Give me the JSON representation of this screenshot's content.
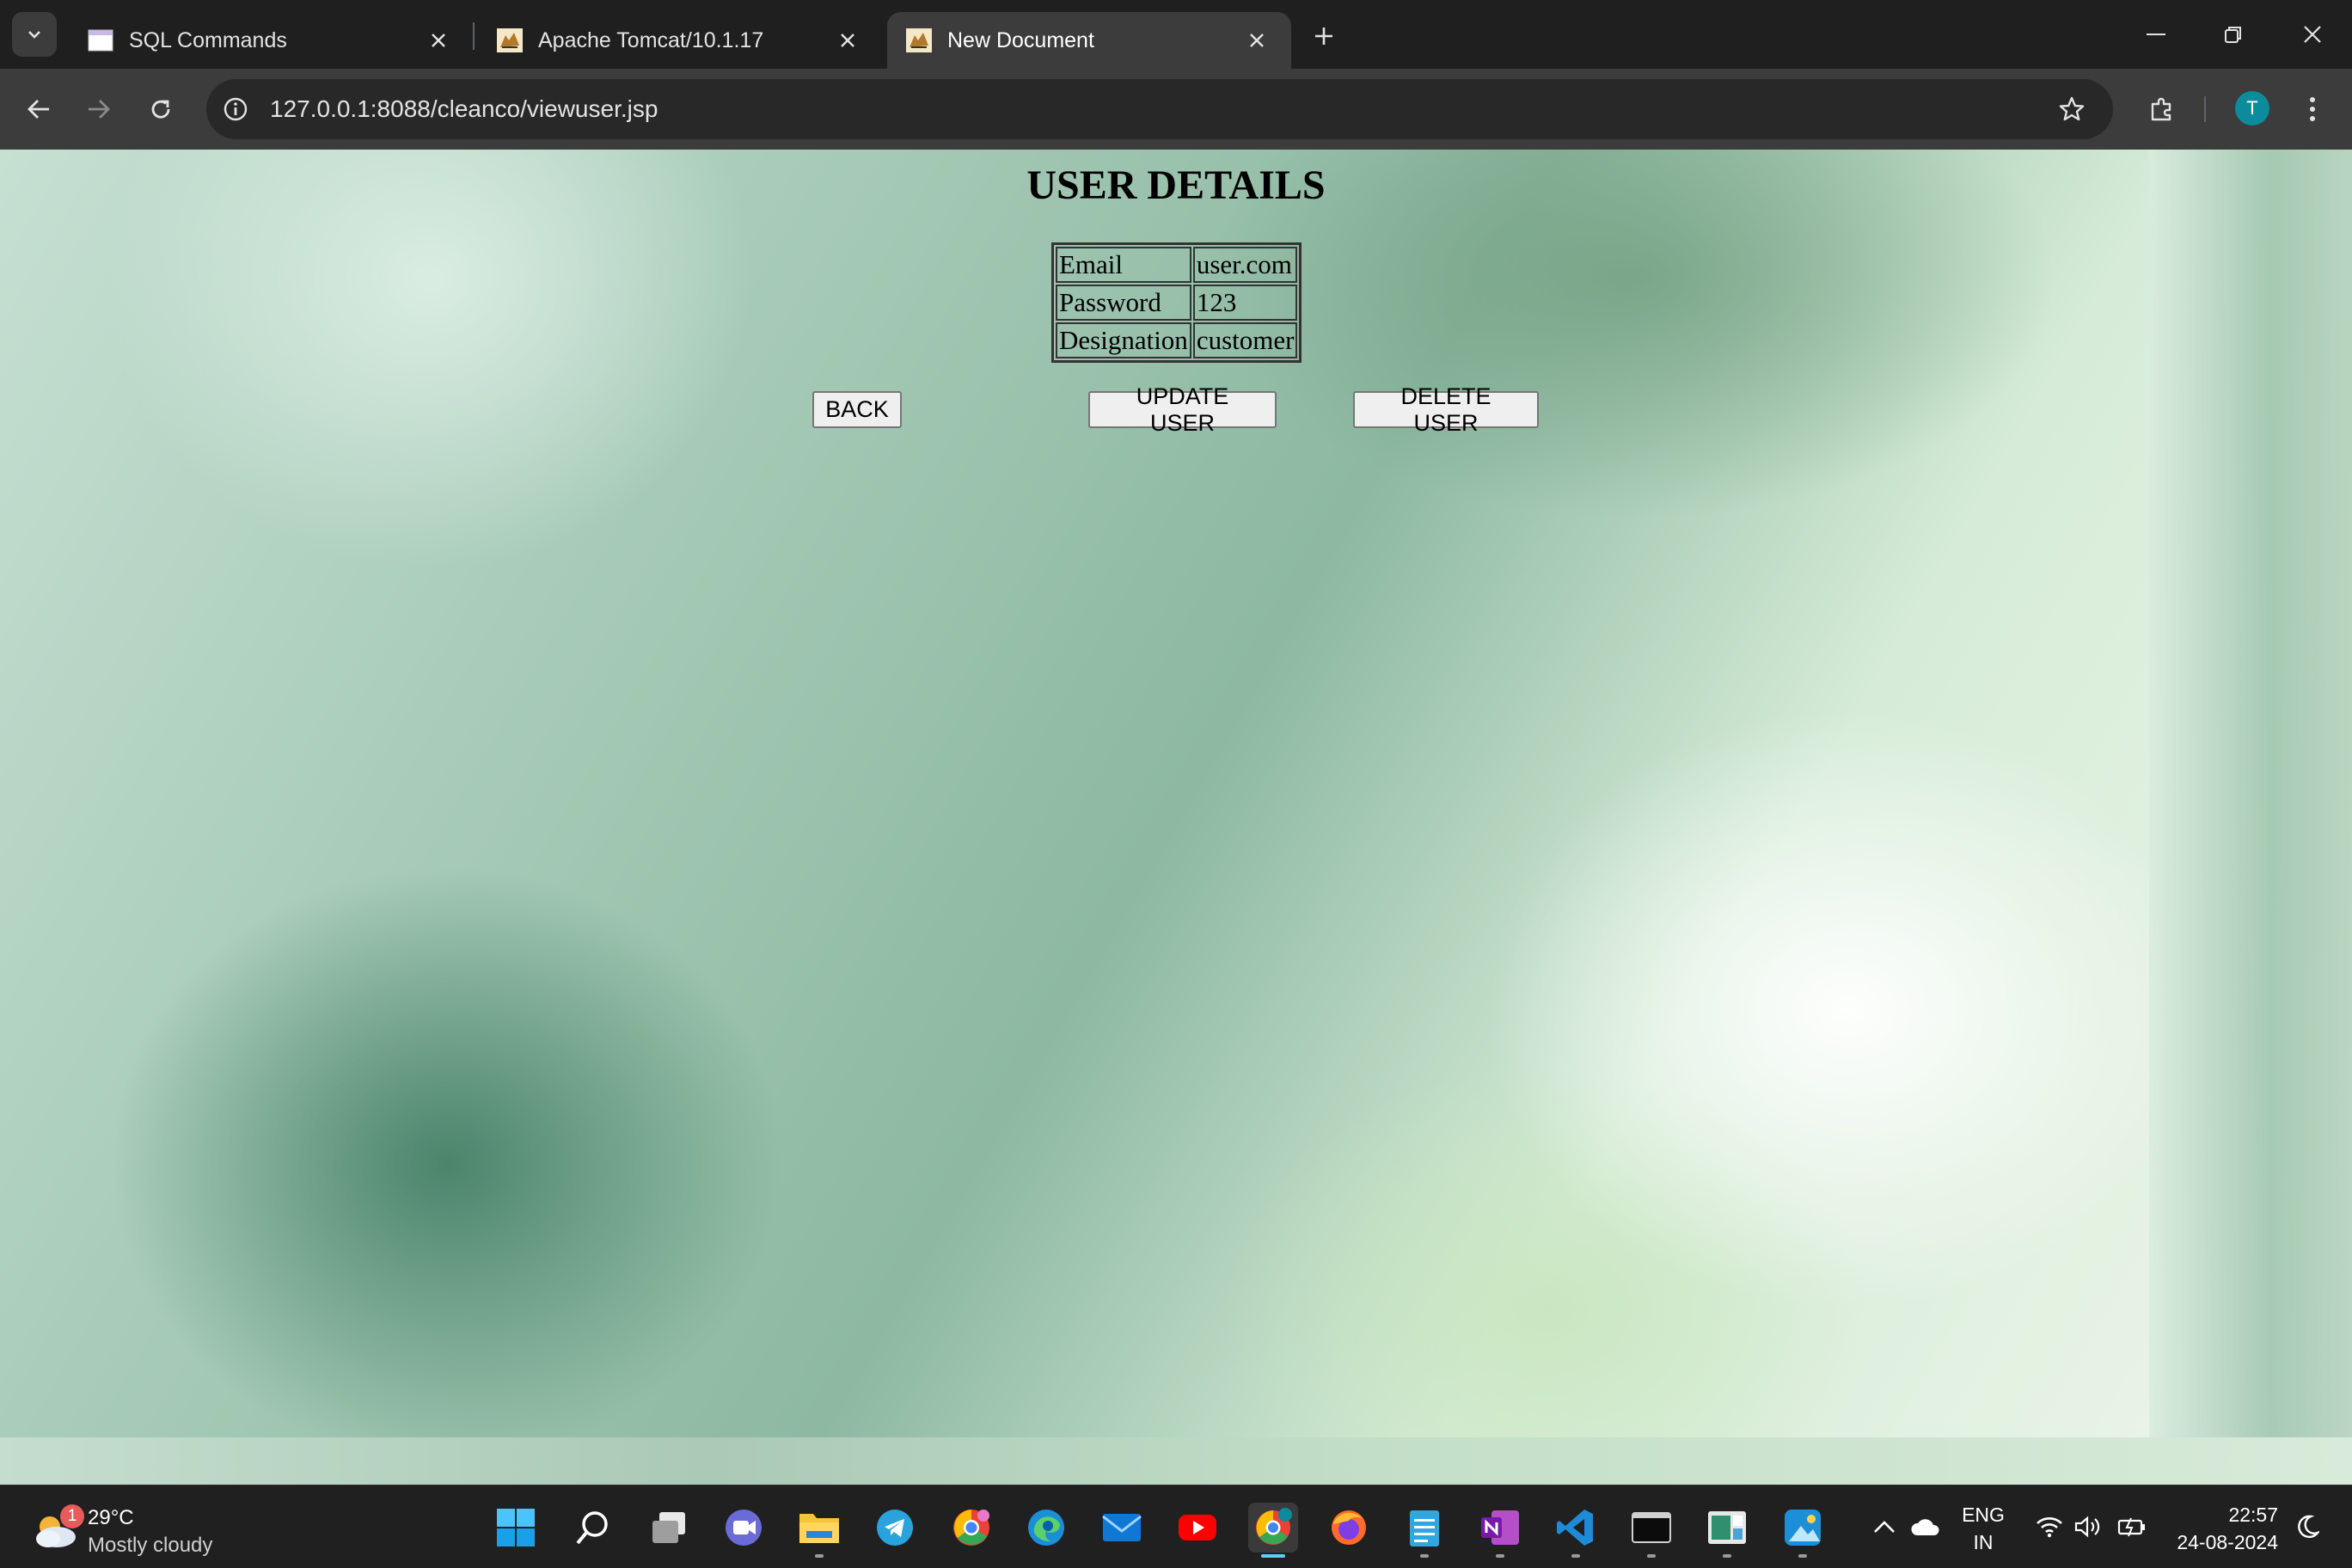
{
  "browser": {
    "tabs": [
      {
        "title": "SQL Commands",
        "icon": "document-window-icon"
      },
      {
        "title": "Apache Tomcat/10.1.17",
        "icon": "tomcat-cat-icon"
      },
      {
        "title": "New Document",
        "icon": "tomcat-cat-icon",
        "active": true
      }
    ],
    "url": "127.0.0.1:8088/cleanco/viewuser.jsp",
    "profile_initial": "T"
  },
  "page": {
    "title": "USER DETAILS",
    "details": [
      {
        "label": "Email",
        "value": "user.com"
      },
      {
        "label": "Password",
        "value": "123"
      },
      {
        "label": "Designation",
        "value": "customer"
      }
    ],
    "buttons": {
      "back": "BACK",
      "update": "UPDATE USER",
      "delete": "DELETE USER"
    }
  },
  "taskbar": {
    "weather": {
      "temp": "29°C",
      "condition": "Mostly cloudy",
      "badge": "1"
    },
    "apps": [
      "start-icon",
      "search-icon",
      "task-view-icon",
      "meet-icon",
      "file-explorer-icon",
      "telegram-icon",
      "chrome-profile-icon",
      "edge-icon",
      "mail-icon",
      "youtube-icon",
      "chrome-icon",
      "firefox-icon",
      "notepad-icon",
      "onenote-icon",
      "vscode-icon",
      "terminal-icon",
      "spreadsheet-app-icon",
      "photos-icon"
    ],
    "language": {
      "line1": "ENG",
      "line2": "IN"
    },
    "clock": {
      "time": "22:57",
      "date": "24-08-2024"
    },
    "colors": {
      "taskbar_bg": "#202020",
      "active_indicator": "#60cdff"
    }
  }
}
